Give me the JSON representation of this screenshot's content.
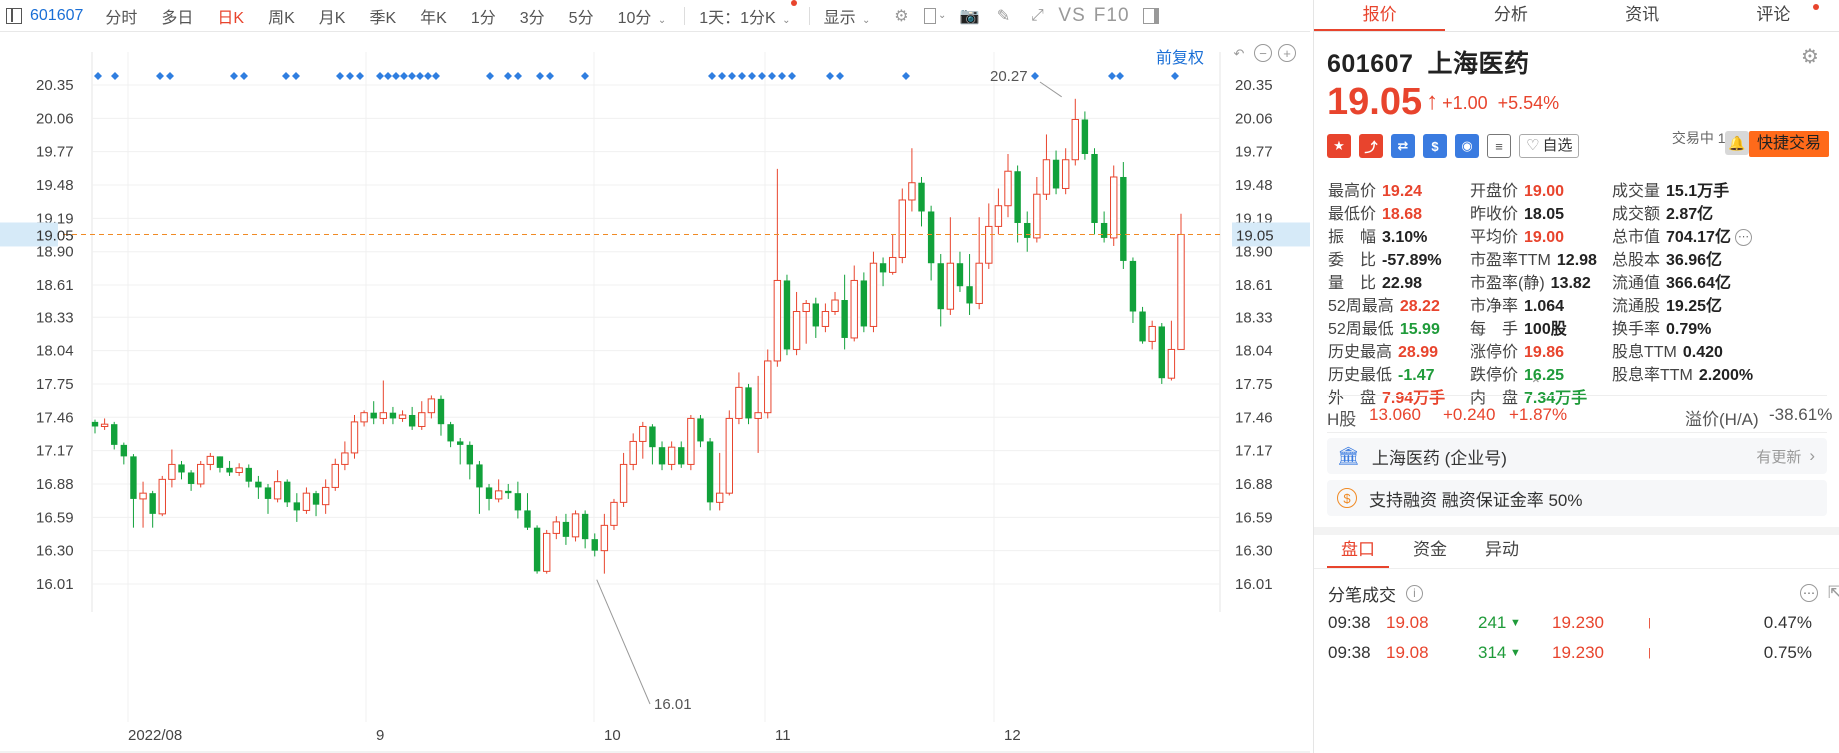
{
  "toolbar": {
    "code": "601607",
    "items": [
      "分时",
      "多日",
      "日K",
      "周K",
      "月K",
      "季K",
      "年K",
      "1分",
      "3分",
      "5分",
      "10分"
    ],
    "active_item": "日K",
    "interval_label": "1天：1分K",
    "display_label": "显示",
    "vs_label": "VS",
    "f10_label": "F10"
  },
  "chart": {
    "adjust_label": "前复权",
    "current_price_tag": "19.05",
    "high_label": "20.27",
    "low_label": "16.01"
  },
  "chart_data": {
    "type": "candlestick",
    "yticks": [
      "20.35",
      "20.06",
      "19.77",
      "19.48",
      "19.19",
      "18.90",
      "18.61",
      "18.33",
      "18.04",
      "17.75",
      "17.46",
      "17.17",
      "16.88",
      "16.59",
      "16.30",
      "16.01"
    ],
    "ylim": [
      16.01,
      20.35
    ],
    "xlabels": [
      "2022/08",
      "9",
      "10",
      "11",
      "12"
    ],
    "last_price": 19.05,
    "candles": [
      [
        17.42,
        17.38,
        17.44,
        17.32
      ],
      [
        17.38,
        17.4,
        17.45,
        17.35
      ],
      [
        17.4,
        17.22,
        17.42,
        17.18
      ],
      [
        17.22,
        17.12,
        17.24,
        17.05
      ],
      [
        17.12,
        16.75,
        17.14,
        16.5
      ],
      [
        16.75,
        16.8,
        16.9,
        16.5
      ],
      [
        16.8,
        16.62,
        16.82,
        16.5
      ],
      [
        16.62,
        16.92,
        16.95,
        16.6
      ],
      [
        16.92,
        17.05,
        17.18,
        16.85
      ],
      [
        17.05,
        16.98,
        17.08,
        16.92
      ],
      [
        16.98,
        16.88,
        17.0,
        16.82
      ],
      [
        16.88,
        17.05,
        17.08,
        16.85
      ],
      [
        17.05,
        17.12,
        17.15,
        17.0
      ],
      [
        17.12,
        17.02,
        17.12,
        16.98
      ],
      [
        17.02,
        16.98,
        17.08,
        16.95
      ],
      [
        16.98,
        17.02,
        17.06,
        16.95
      ],
      [
        17.02,
        16.9,
        17.05,
        16.85
      ],
      [
        16.9,
        16.85,
        16.95,
        16.75
      ],
      [
        16.85,
        16.75,
        16.88,
        16.62
      ],
      [
        16.75,
        16.9,
        17.0,
        16.72
      ],
      [
        16.9,
        16.72,
        16.92,
        16.68
      ],
      [
        16.72,
        16.65,
        16.8,
        16.55
      ],
      [
        16.65,
        16.8,
        16.85,
        16.62
      ],
      [
        16.8,
        16.7,
        16.82,
        16.6
      ],
      [
        16.7,
        16.85,
        16.92,
        16.62
      ],
      [
        16.85,
        17.05,
        17.1,
        16.82
      ],
      [
        17.05,
        17.15,
        17.25,
        17.0
      ],
      [
        17.15,
        17.42,
        17.48,
        17.1
      ],
      [
        17.42,
        17.5,
        17.52,
        17.38
      ],
      [
        17.5,
        17.45,
        17.6,
        17.4
      ],
      [
        17.45,
        17.5,
        17.78,
        17.4
      ],
      [
        17.5,
        17.45,
        17.55,
        17.4
      ],
      [
        17.45,
        17.48,
        17.52,
        17.42
      ],
      [
        17.48,
        17.38,
        17.55,
        17.35
      ],
      [
        17.38,
        17.5,
        17.6,
        17.35
      ],
      [
        17.5,
        17.62,
        17.65,
        17.45
      ],
      [
        17.62,
        17.4,
        17.65,
        17.3
      ],
      [
        17.4,
        17.25,
        17.42,
        17.2
      ],
      [
        17.25,
        17.22,
        17.28,
        17.05
      ],
      [
        17.22,
        17.05,
        17.25,
        16.92
      ],
      [
        17.05,
        16.85,
        17.08,
        16.62
      ],
      [
        16.85,
        16.75,
        16.88,
        16.65
      ],
      [
        16.75,
        16.82,
        16.92,
        16.72
      ],
      [
        16.82,
        16.8,
        16.88,
        16.75
      ],
      [
        16.8,
        16.65,
        16.9,
        16.58
      ],
      [
        16.65,
        16.5,
        16.8,
        16.48
      ],
      [
        16.5,
        16.12,
        16.52,
        16.1
      ],
      [
        16.12,
        16.45,
        16.48,
        16.1
      ],
      [
        16.45,
        16.55,
        16.6,
        16.4
      ],
      [
        16.55,
        16.42,
        16.62,
        16.35
      ],
      [
        16.42,
        16.62,
        16.65,
        16.38
      ],
      [
        16.62,
        16.4,
        16.65,
        16.32
      ],
      [
        16.4,
        16.3,
        16.45,
        16.25
      ],
      [
        16.3,
        16.52,
        16.62,
        16.1
      ],
      [
        16.52,
        16.72,
        16.75,
        16.48
      ],
      [
        16.72,
        17.05,
        17.15,
        16.68
      ],
      [
        17.05,
        17.25,
        17.32,
        17.0
      ],
      [
        17.25,
        17.38,
        17.42,
        17.1
      ],
      [
        17.38,
        17.2,
        17.4,
        17.05
      ],
      [
        17.2,
        17.05,
        17.25,
        17.0
      ],
      [
        17.05,
        17.2,
        17.25,
        17.0
      ],
      [
        17.2,
        17.05,
        17.25,
        17.02
      ],
      [
        17.05,
        17.45,
        17.48,
        17.0
      ],
      [
        17.45,
        17.25,
        17.48,
        17.2
      ],
      [
        17.25,
        16.72,
        17.28,
        16.65
      ],
      [
        16.72,
        16.8,
        17.15,
        16.65
      ],
      [
        16.8,
        17.45,
        17.52,
        16.78
      ],
      [
        17.45,
        17.72,
        17.85,
        17.4
      ],
      [
        17.72,
        17.45,
        17.75,
        17.4
      ],
      [
        17.45,
        17.5,
        17.82,
        17.15
      ],
      [
        17.5,
        17.95,
        18.05,
        17.45
      ],
      [
        17.95,
        18.65,
        19.62,
        17.9
      ],
      [
        18.65,
        18.05,
        18.7,
        18.0
      ],
      [
        18.05,
        18.38,
        18.55,
        18.0
      ],
      [
        18.38,
        18.45,
        18.48,
        18.1
      ],
      [
        18.45,
        18.25,
        18.5,
        18.15
      ],
      [
        18.25,
        18.38,
        18.45,
        18.2
      ],
      [
        18.38,
        18.48,
        18.55,
        18.35
      ],
      [
        18.48,
        18.15,
        18.7,
        18.05
      ],
      [
        18.15,
        18.65,
        18.78,
        18.12
      ],
      [
        18.65,
        18.25,
        18.72,
        18.2
      ],
      [
        18.25,
        18.8,
        18.9,
        18.2
      ],
      [
        18.8,
        18.72,
        18.85,
        18.6
      ],
      [
        18.72,
        18.85,
        19.05,
        18.7
      ],
      [
        18.85,
        19.35,
        19.45,
        18.8
      ],
      [
        19.35,
        19.5,
        19.8,
        19.25
      ],
      [
        19.5,
        19.25,
        19.55,
        19.12
      ],
      [
        19.25,
        18.8,
        19.3,
        18.65
      ],
      [
        18.8,
        18.4,
        18.88,
        18.25
      ],
      [
        18.4,
        18.8,
        19.2,
        18.35
      ],
      [
        18.8,
        18.6,
        18.9,
        18.55
      ],
      [
        18.6,
        18.45,
        18.88,
        18.35
      ],
      [
        18.45,
        18.8,
        19.2,
        18.4
      ],
      [
        18.8,
        19.12,
        19.32,
        18.75
      ],
      [
        19.12,
        19.3,
        19.45,
        19.05
      ],
      [
        19.3,
        19.6,
        19.75,
        19.2
      ],
      [
        19.6,
        19.15,
        19.65,
        18.98
      ],
      [
        19.15,
        19.02,
        19.25,
        18.9
      ],
      [
        19.02,
        19.4,
        19.55,
        18.98
      ],
      [
        19.4,
        19.7,
        19.92,
        19.35
      ],
      [
        19.7,
        19.45,
        19.78,
        19.4
      ],
      [
        19.45,
        19.7,
        19.8,
        19.4
      ],
      [
        19.7,
        20.05,
        20.23,
        19.65
      ],
      [
        20.05,
        19.75,
        20.12,
        19.7
      ],
      [
        19.75,
        19.15,
        19.8,
        19.05
      ],
      [
        19.15,
        19.02,
        19.25,
        18.98
      ],
      [
        19.02,
        19.55,
        19.65,
        18.95
      ],
      [
        19.55,
        18.82,
        19.68,
        18.75
      ],
      [
        18.82,
        18.38,
        18.85,
        18.28
      ],
      [
        18.38,
        18.12,
        18.42,
        18.1
      ],
      [
        18.12,
        18.25,
        18.3,
        18.05
      ],
      [
        18.25,
        17.8,
        18.28,
        17.75
      ],
      [
        17.8,
        18.05,
        18.3,
        17.78
      ],
      [
        18.05,
        19.05,
        19.23,
        18.68
      ]
    ]
  },
  "panel": {
    "tabs": [
      "报价",
      "分析",
      "资讯",
      "评论"
    ],
    "code": "601607",
    "name": "上海医药",
    "price": "19.05",
    "change": "+1.00",
    "change_pct": "+5.54%",
    "trade_time": "交易中 12/26 09:38(北京)",
    "watch_label": "自选",
    "quick_trade": "快捷交易",
    "col1": [
      [
        "最高价",
        "19.24",
        "red"
      ],
      [
        "最低价",
        "18.68",
        "red"
      ],
      [
        "振　幅",
        "3.10%",
        "dark"
      ],
      [
        "委　比",
        "-57.89%",
        "dark"
      ],
      [
        "量　比",
        "22.98",
        "dark"
      ],
      [
        "52周最高",
        "28.22",
        "red"
      ],
      [
        "52周最低",
        "15.99",
        "green"
      ],
      [
        "历史最高",
        "28.99",
        "red"
      ],
      [
        "历史最低",
        "-1.47",
        "green"
      ],
      [
        "外　盘",
        "7.94万手",
        "red"
      ]
    ],
    "col2": [
      [
        "开盘价",
        "19.00",
        "red"
      ],
      [
        "昨收价",
        "18.05",
        "dark"
      ],
      [
        "平均价",
        "19.00",
        "red"
      ],
      [
        "市盈率TTM",
        "12.98",
        "dark"
      ],
      [
        "市盈率(静)",
        "13.82",
        "dark"
      ],
      [
        "市净率",
        "1.064",
        "dark"
      ],
      [
        "每　手",
        "100股",
        "dark"
      ],
      [
        "涨停价",
        "19.86",
        "red"
      ],
      [
        "跌停价",
        "16.25",
        "green"
      ],
      [
        "内　盘",
        "7.34万手",
        "green"
      ]
    ],
    "col3": [
      [
        "成交量",
        "15.1万手",
        "dark"
      ],
      [
        "成交额",
        "2.87亿",
        "dark"
      ],
      [
        "总市值",
        "704.17亿",
        "dark"
      ],
      [
        "总股本",
        "36.96亿",
        "dark"
      ],
      [
        "流通值",
        "366.64亿",
        "dark"
      ],
      [
        "流通股",
        "19.25亿",
        "dark"
      ],
      [
        "换手率",
        "0.79%",
        "dark"
      ],
      [
        "股息TTM",
        "0.420",
        "dark"
      ],
      [
        "股息率TTM",
        "2.200%",
        "dark"
      ]
    ],
    "h_label": "H股",
    "h_price": "13.060",
    "h_change": "+0.240",
    "h_pct": "+1.87%",
    "premium_label": "溢价(H/A)",
    "premium_value": "-38.61%",
    "enterprise": "上海医药 (企业号)",
    "enterprise_update": "有更新",
    "margin_text": "支持融资 融资保证金率 50%",
    "bottom_tabs": [
      "盘口",
      "资金",
      "异动"
    ],
    "fenbi_title": "分笔成交",
    "trades": [
      [
        "09:38",
        "19.08",
        "241",
        "19.230",
        "0.47%"
      ],
      [
        "09:38",
        "19.08",
        "314",
        "19.230",
        "0.75%"
      ]
    ]
  }
}
